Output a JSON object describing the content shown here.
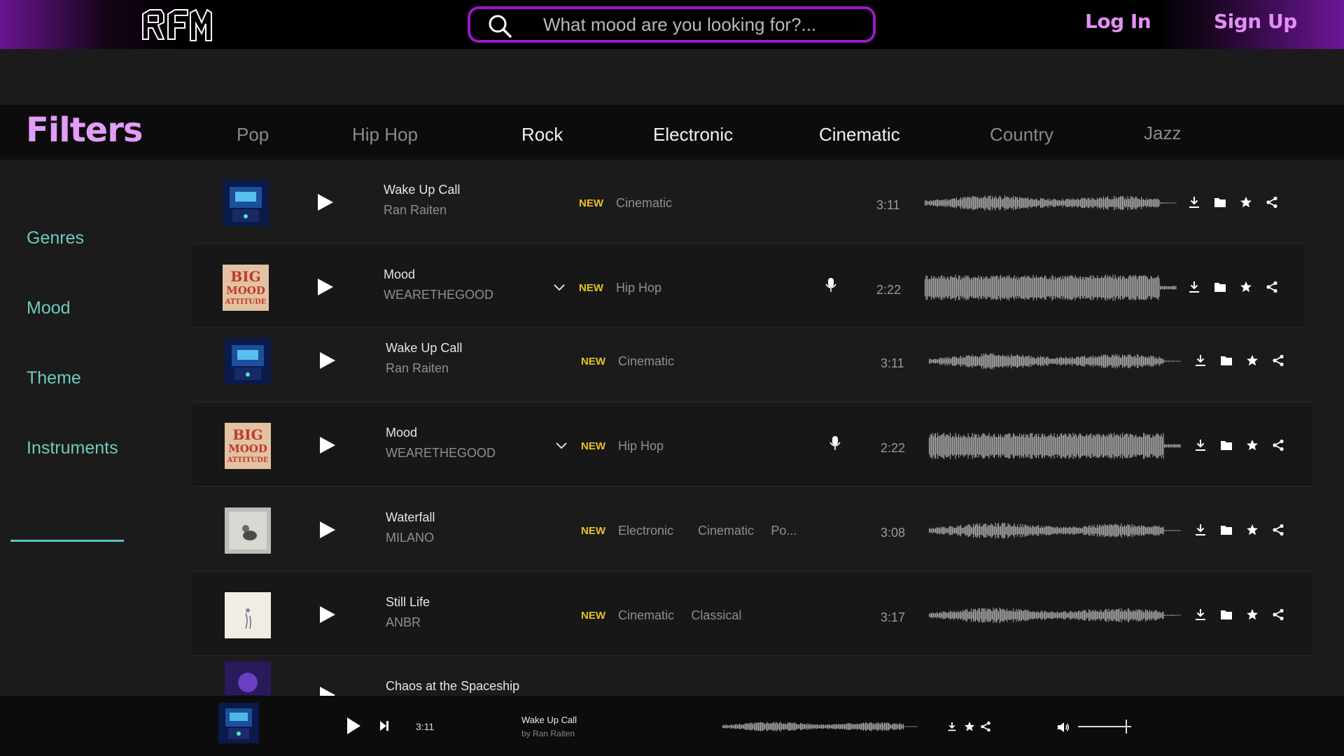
{
  "header": {
    "logo_text": "RFM",
    "search_placeholder": "What mood are you looking for?...",
    "login_label": "Log In",
    "signup_label": "Sign Up",
    "accent_color": "#9b17c6",
    "auth_color": "#e28ff5"
  },
  "filters_title": "Filters",
  "genres": [
    "Pop",
    "Hip Hop",
    "Rock",
    "Electronic",
    "Cinematic",
    "Country",
    "Jazz"
  ],
  "active_genres": [
    "Rock",
    "Electronic",
    "Cinematic"
  ],
  "sidebar": {
    "items": [
      "Genres",
      "Mood",
      "Theme",
      "Instruments"
    ],
    "color": "#6fcabc"
  },
  "new_badge": "NEW",
  "tracks": [
    {
      "title": "Wake Up Call",
      "artist": "Ran Raiten",
      "tags": [
        "Cinematic"
      ],
      "duration": "3:11",
      "cover": "blue-screen",
      "vocals": false,
      "expandable": false
    },
    {
      "title": "Mood",
      "artist": "WEARETHEGOOD",
      "tags": [
        "Hip Hop"
      ],
      "duration": "2:22",
      "cover": "big-mood-attitude",
      "vocals": true,
      "expandable": true
    },
    {
      "title": "Wake Up Call",
      "artist": "Ran Raiten",
      "tags": [
        "Cinematic"
      ],
      "duration": "3:11",
      "cover": "blue-screen",
      "vocals": false,
      "expandable": false
    },
    {
      "title": "Mood",
      "artist": "WEARETHEGOOD",
      "tags": [
        "Hip Hop"
      ],
      "duration": "2:22",
      "cover": "big-mood-attitude",
      "vocals": true,
      "expandable": true
    },
    {
      "title": "Waterfall",
      "artist": "MILANO",
      "tags": [
        "Electronic",
        "Cinematic",
        "Po..."
      ],
      "duration": "3:08",
      "cover": "grey-photo",
      "vocals": false,
      "expandable": false
    },
    {
      "title": "Still Life",
      "artist": "ANBR",
      "tags": [
        "Cinematic",
        "Classical"
      ],
      "duration": "3:17",
      "cover": "white-sketch",
      "vocals": false,
      "expandable": false
    },
    {
      "title": "Chaos at the Spaceship",
      "artist": "",
      "tags": [],
      "duration": "",
      "cover": "purple-space",
      "vocals": false,
      "expandable": false
    }
  ],
  "row_icons": [
    "download-icon",
    "folder-icon",
    "star-icon",
    "share-icon"
  ],
  "player": {
    "time": "3:11",
    "title": "Wake Up Call",
    "artist": "by Ran Raiten",
    "volume": 1.0
  },
  "badge_color": "#e8c02a"
}
